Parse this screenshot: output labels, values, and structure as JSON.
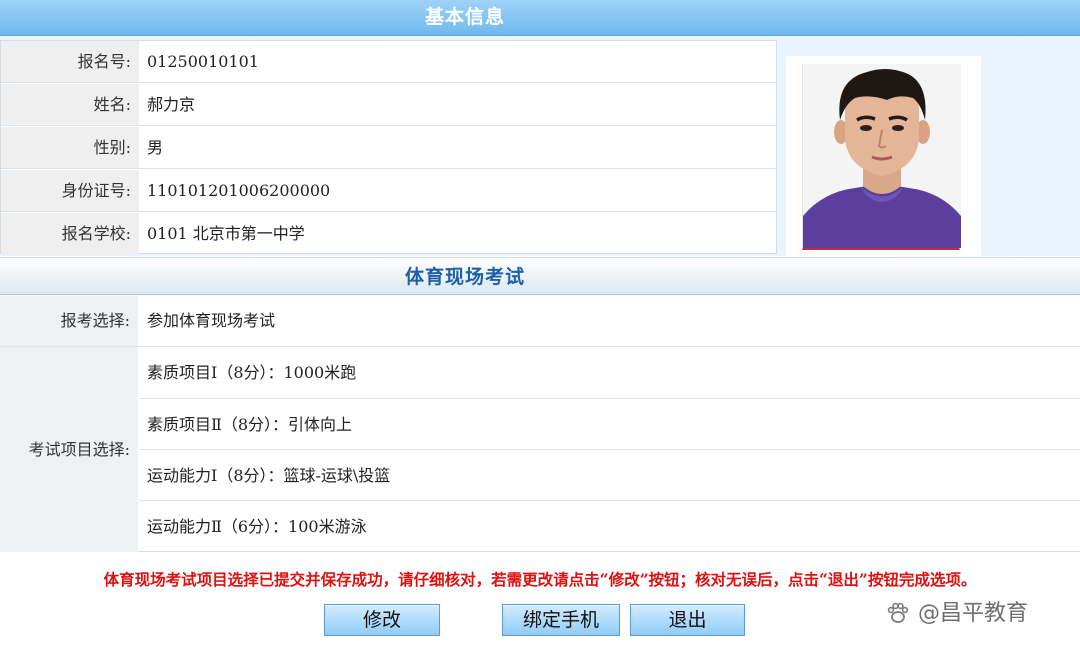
{
  "basic_info": {
    "title": "基本信息",
    "rows": [
      {
        "label": "报名号:",
        "value": "01250010101"
      },
      {
        "label": "姓名:",
        "value": "郝力京"
      },
      {
        "label": "性别:",
        "value": "男"
      },
      {
        "label": "身份证号:",
        "value": "110101201006200000"
      },
      {
        "label": "报名学校:",
        "value": "0101  北京市第一中学"
      }
    ]
  },
  "sports_exam": {
    "title": "体育现场考试",
    "registration_label": "报考选择:",
    "registration_value": "参加体育现场考试",
    "items_label": "考试项目选择:",
    "items": [
      "素质项目Ⅰ（8分）：1000米跑",
      "素质项目Ⅱ（8分）：引体向上",
      "运动能力Ⅰ（8分）：篮球-运球\\投篮",
      "运动能力Ⅱ（6分）：100米游泳"
    ]
  },
  "notice": "体育现场考试项目选择已提交并保存成功，请仔细核对，若需更改请点击“修改”按钮；核对无误后，点击“退出”按钮完成选项。",
  "buttons": {
    "modify": "修改",
    "bind_phone": "绑定手机",
    "exit": "退出"
  },
  "watermark": "@昌平教育",
  "colors": {
    "header_blue": "#6fb8ee",
    "section_title": "#1d5fa8",
    "notice_red": "#e01010",
    "button_blue": "#8fccf6"
  }
}
